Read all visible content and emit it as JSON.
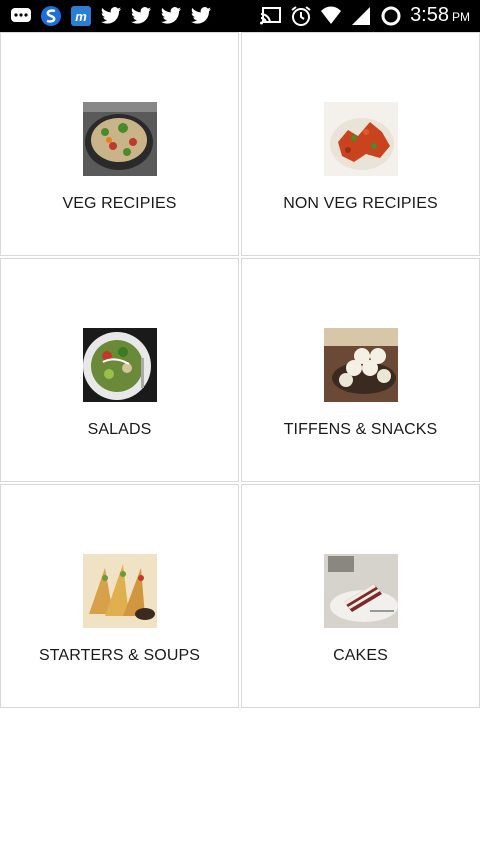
{
  "status_bar": {
    "time": "3:58",
    "ampm": "PM",
    "left_icons": [
      "chat-icon",
      "swype-icon",
      "m-app-icon",
      "twitter-icon",
      "twitter-icon",
      "twitter-icon",
      "twitter-icon"
    ],
    "right_icons": [
      "cast-icon",
      "alarm-icon",
      "wifi-icon",
      "signal-icon",
      "battery-icon"
    ]
  },
  "categories": [
    {
      "label": "VEG RECIPIES",
      "icon": "veg-recipes-image"
    },
    {
      "label": "NON VEG RECIPIES",
      "icon": "non-veg-recipes-image"
    },
    {
      "label": "SALADS",
      "icon": "salads-image"
    },
    {
      "label": "TIFFENS & SNACKS",
      "icon": "tiffens-snacks-image"
    },
    {
      "label": "STARTERS & SOUPS",
      "icon": "starters-soups-image"
    },
    {
      "label": "CAKES",
      "icon": "cakes-image"
    }
  ],
  "colors": {
    "status_bar": "#000000",
    "background": "#ffffff",
    "cell_border": "#d8d8d8",
    "label": "#1a1a1a"
  }
}
